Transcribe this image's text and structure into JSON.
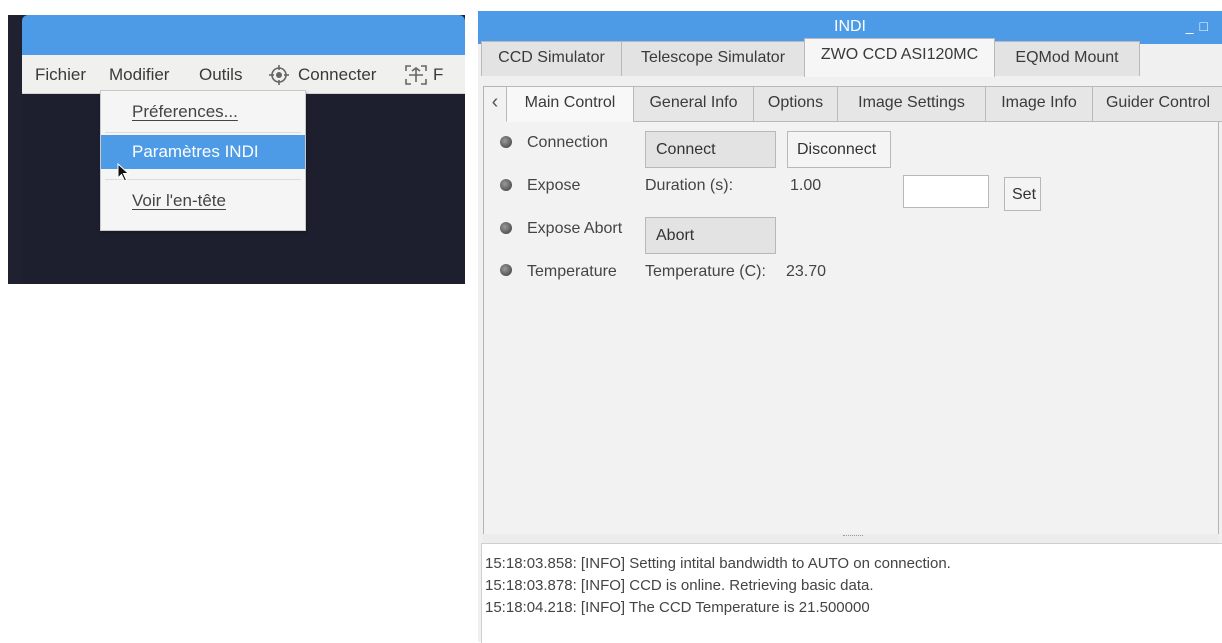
{
  "left_app": {
    "menu": {
      "fichier": "Fichier",
      "modifier": "Modifier",
      "outils": "Outils",
      "connecter": "Connecter",
      "f_partial": "F"
    },
    "dropdown": {
      "preferences": "Préferences...",
      "parametres_indi": "Paramètres INDI",
      "voir_entete": "Voir l'en-tête"
    }
  },
  "indi": {
    "title": "INDI",
    "device_tabs": [
      "CCD Simulator",
      "Telescope Simulator",
      "ZWO CCD ASI120MC",
      "EQMod Mount"
    ],
    "active_device": "ZWO CCD ASI120MC",
    "group_tabs": [
      "Main Control",
      "General Info",
      "Options",
      "Image Settings",
      "Image Info",
      "Guider Control"
    ],
    "active_group": "Main Control",
    "properties": {
      "connection": {
        "label": "Connection",
        "connect": "Connect",
        "disconnect": "Disconnect"
      },
      "expose": {
        "label": "Expose",
        "duration_label": "Duration (s):",
        "duration_value": "1.00",
        "input_value": "",
        "set": "Set"
      },
      "expose_abort": {
        "label": "Expose Abort",
        "abort": "Abort"
      },
      "temperature": {
        "label": "Temperature",
        "temp_label": "Temperature (C):",
        "temp_value": "23.70"
      }
    },
    "log": [
      "15:18:03.858: [INFO] Setting intital bandwidth to AUTO on connection.",
      "15:18:03.878: [INFO] CCD is online. Retrieving basic data.",
      "15:18:04.218: [INFO] The CCD Temperature is 21.500000"
    ]
  },
  "colors": {
    "accent": "#4d9be6",
    "dark_canvas": "#1d1f2e",
    "panel_bg": "#f0f0f0",
    "led_idle": "#777777"
  }
}
